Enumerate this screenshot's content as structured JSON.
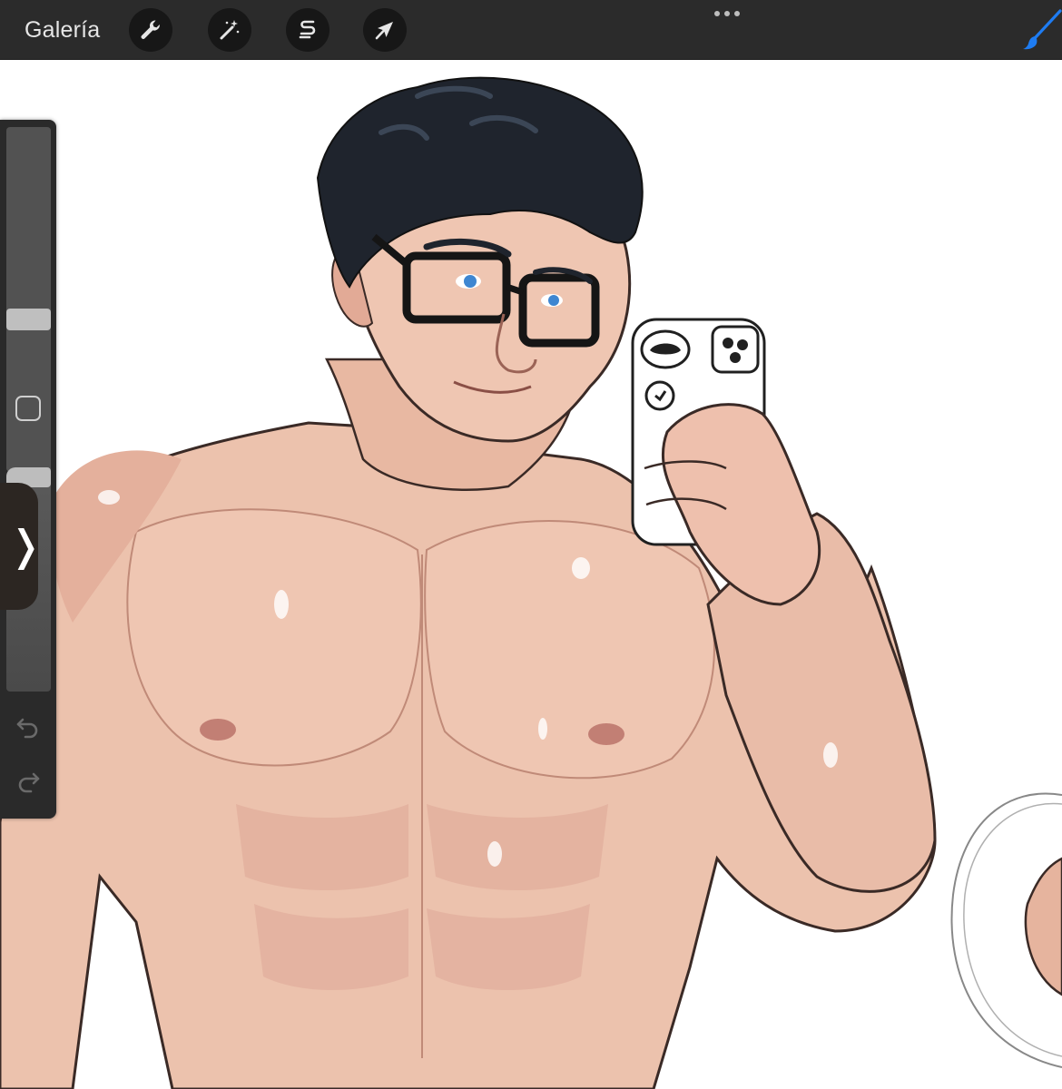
{
  "toolbar": {
    "gallery_label": "Galería",
    "tools": [
      {
        "name": "actions",
        "icon": "wrench-icon"
      },
      {
        "name": "adjustments",
        "icon": "magic-wand-icon"
      },
      {
        "name": "selection",
        "icon": "selection-s-icon"
      },
      {
        "name": "transform",
        "icon": "arrow-cursor-icon"
      }
    ],
    "right_tools": [
      {
        "name": "more",
        "icon": "more-dots-icon"
      },
      {
        "name": "brush",
        "icon": "brush-icon",
        "active_color": "#1e7cf2"
      }
    ]
  },
  "sidebar": {
    "brush_size_level": 0.55,
    "brush_opacity_level": 1.0,
    "buttons": [
      {
        "name": "modify",
        "icon": "square-modify-icon"
      },
      {
        "name": "collapse",
        "icon": "chevron-right-icon",
        "glyph": "❭"
      },
      {
        "name": "undo",
        "icon": "undo-arrow-icon"
      },
      {
        "name": "redo",
        "icon": "redo-arrow-icon"
      }
    ]
  },
  "canvas": {
    "content": "illustration",
    "colors": {
      "background": "#ffffff",
      "skin": "#ecc2ad",
      "skin_shadow": "#d89e8a",
      "hair": "#1f242d",
      "eyes": "#3e86d1",
      "phone": "#ffffff"
    }
  },
  "colors": {
    "toolbar_bg": "#2b2b2b",
    "button_bg": "#171717",
    "icon": "#e6e6e6",
    "accent": "#1e7cf2"
  }
}
